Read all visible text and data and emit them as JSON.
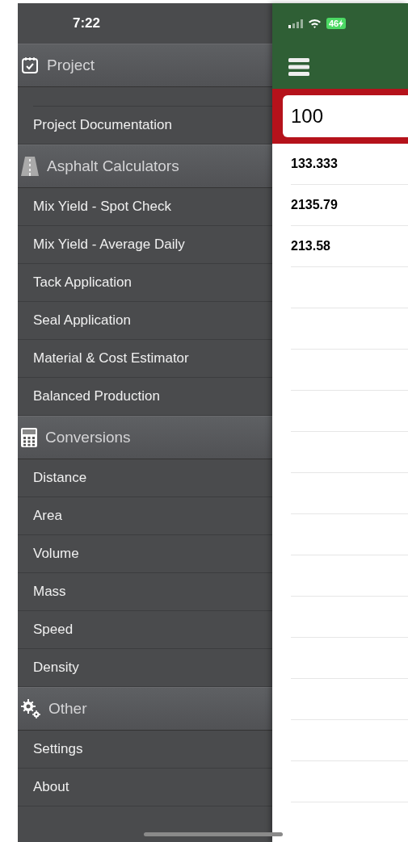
{
  "status_bar": {
    "time": "7:22",
    "battery": "46"
  },
  "drawer": {
    "sections": [
      {
        "title": "Project",
        "items": [
          "Project Documentation"
        ]
      },
      {
        "title": "Asphalt Calculators",
        "items": [
          "Mix Yield - Spot Check",
          "Mix Yield - Average Daily",
          "Tack Application",
          "Seal Application",
          "Material & Cost Estimator",
          "Balanced Production"
        ]
      },
      {
        "title": "Conversions",
        "items": [
          "Distance",
          "Area",
          "Volume",
          "Mass",
          "Speed",
          "Density"
        ]
      },
      {
        "title": "Other",
        "items": [
          "Settings",
          "About"
        ]
      }
    ]
  },
  "main": {
    "input": {
      "value": "100"
    },
    "results": [
      "133.333",
      "2135.79",
      "213.58"
    ]
  }
}
